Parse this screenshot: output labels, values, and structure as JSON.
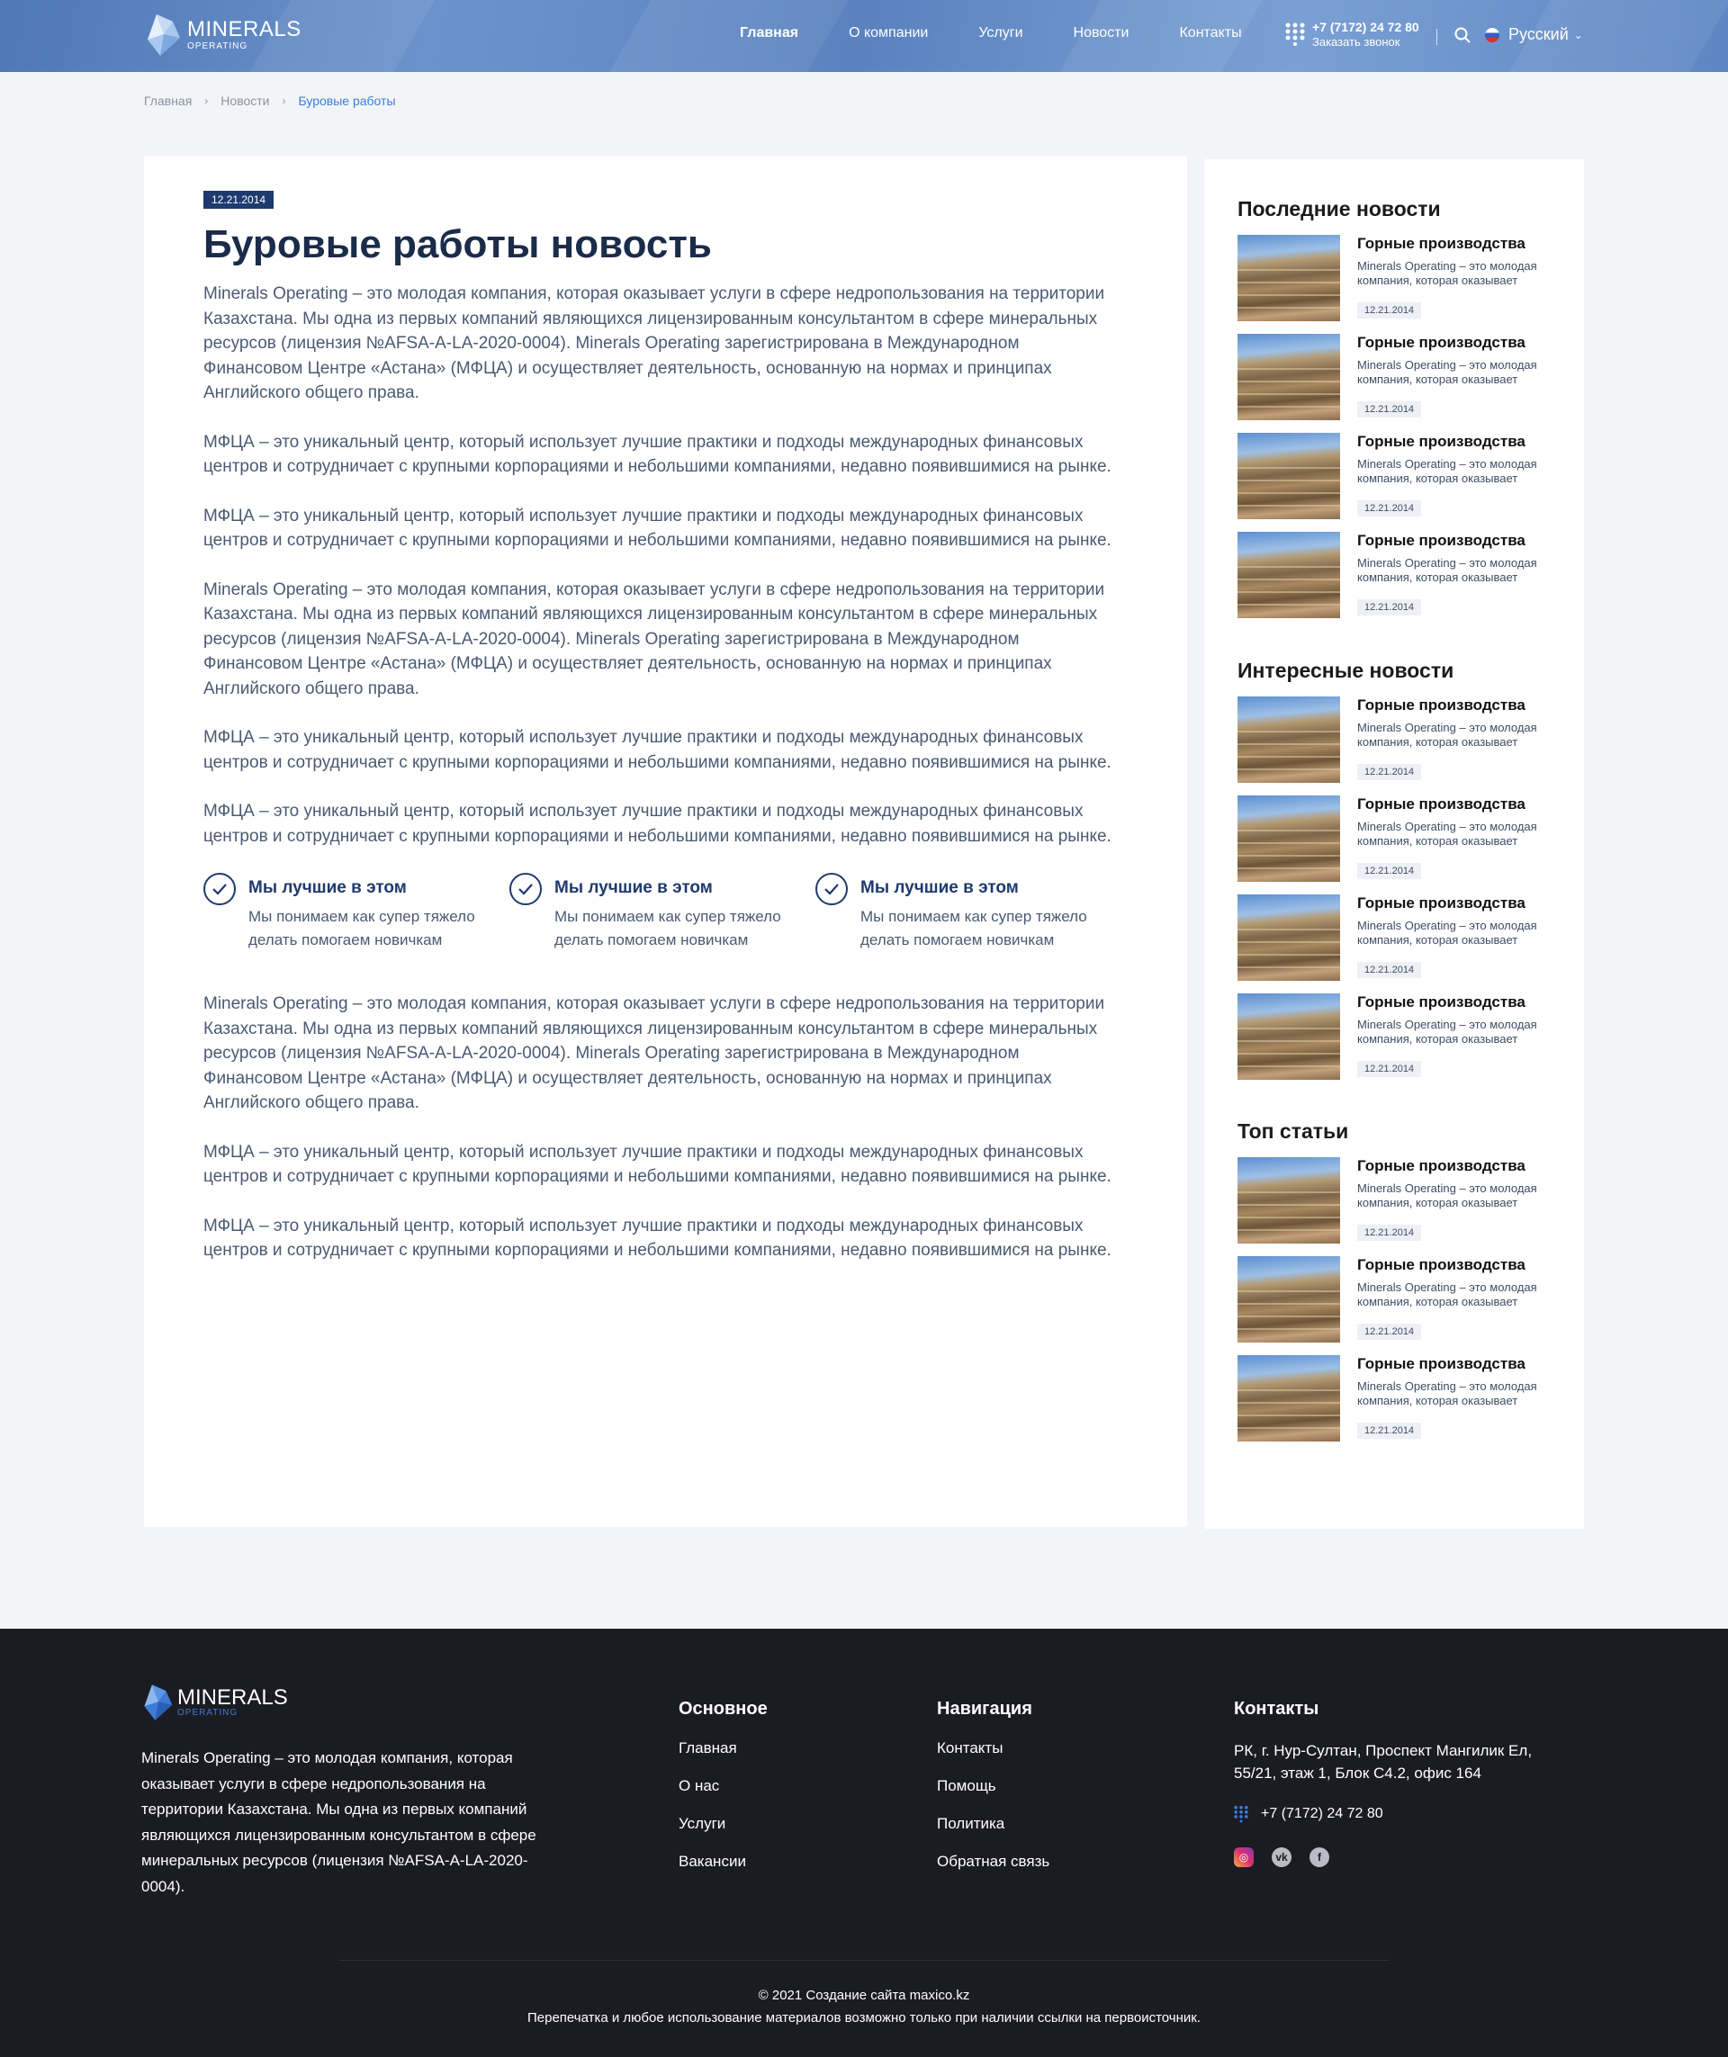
{
  "header": {
    "logo_line1": "MINERALS",
    "logo_line2": "OPERATING",
    "nav": [
      "Главная",
      "О компании",
      "Услуги",
      "Новости",
      "Контакты"
    ],
    "phone": "+7 (7172) 24 72 80",
    "callback": "Заказать звонок",
    "language": "Русский"
  },
  "breadcrumb": [
    "Главная",
    "Новости",
    "Буровые работы"
  ],
  "article": {
    "date": "12.21.2014",
    "title": "Буровые работы новость",
    "p_intro": "Minerals Operating – это молодая компания, которая оказывает услуги в сфере недропользования на территории Казахстана. Мы одна из первых компаний являющихся лицензированным консультантом в сфере минеральных ресурсов (лицензия №AFSA-A-LA-2020-0004). Minerals Operating зарегистрирована в Международном Финансовом Центре «Астана» (МФЦА) и осуществляет деятельность, основанную на нормах и принципах Английского общего права.",
    "p_mfca": "МФЦА – это уникальный центр, который использует лучшие практики и подходы международных финансовых центров и сотрудничает с крупными корпорациями и небольшими компаниями, недавно появившимися на рынке.",
    "features": [
      {
        "title": "Мы лучшие в этом",
        "desc": "Мы понимаем как супер тяжело делать помогаем новичкам"
      },
      {
        "title": "Мы лучшие в этом",
        "desc": "Мы понимаем как супер тяжело делать помогаем новичкам"
      },
      {
        "title": "Мы лучшие в этом",
        "desc": "Мы понимаем как супер тяжело делать помогаем новичкам"
      }
    ]
  },
  "sidebar": {
    "sections": [
      {
        "title": "Последние новости",
        "count": 4
      },
      {
        "title": "Интересные новости",
        "count": 4
      },
      {
        "title": "Топ статьи",
        "count": 3
      }
    ],
    "item": {
      "title": "Горные производства",
      "desc": "Minerals Operating – это молодая компания, которая оказывает услуги",
      "date": "12.21.2014"
    }
  },
  "footer": {
    "logo_line1": "MINERALS",
    "logo_line2": "OPERATING",
    "about": "Minerals Operating – это молодая компания, которая оказывает услуги в сфере недропользования на территории Казахстана. Мы одна из первых компаний являющихся лицензированным консультантом в сфере минеральных ресурсов (лицензия №AFSA-A-LA-2020-0004).",
    "col_main": {
      "title": "Основное",
      "links": [
        "Главная",
        "О нас",
        "Услуги",
        "Вакансии"
      ]
    },
    "col_nav": {
      "title": "Навигация",
      "links": [
        "Контакты",
        "Помощь",
        "Политика",
        "Обратная связь"
      ]
    },
    "col_contacts": {
      "title": "Контакты",
      "address": "РК, г. Нур-Султан, Проспект Мангилик Ел, 55/21, этаж 1, Блок С4.2, офис 164",
      "phone": "+7 (7172) 24 72 80"
    },
    "copyright": "© 2021 Создание сайта maxico.kz",
    "note": "Перепечатка и любое использование материалов возможно только при наличии ссылки на первоисточник."
  },
  "colors": {
    "accent": "#3b7fd8",
    "dark_blue": "#1f3a6e",
    "footer_bg": "#1b1c21",
    "header_bg": "#5a82bf"
  }
}
